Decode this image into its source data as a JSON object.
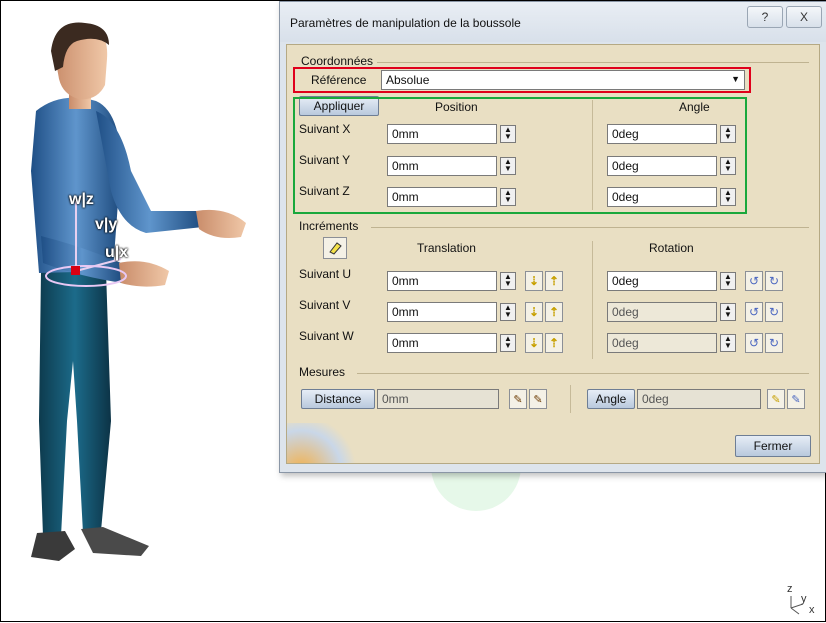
{
  "dialog": {
    "title": "Paramètres de manipulation de la boussole",
    "help_glyph": "?",
    "close_glyph": "X"
  },
  "coords": {
    "group_label": "Coordonnées",
    "reference_label": "Référence",
    "reference_value": "Absolue",
    "apply_label": "Appliquer",
    "position_header": "Position",
    "angle_header": "Angle",
    "rows": [
      {
        "label": "Suivant X",
        "position": "0mm",
        "angle": "0deg"
      },
      {
        "label": "Suivant Y",
        "position": "0mm",
        "angle": "0deg"
      },
      {
        "label": "Suivant Z",
        "position": "0mm",
        "angle": "0deg"
      }
    ]
  },
  "increments": {
    "group_label": "Incréments",
    "translation_header": "Translation",
    "rotation_header": "Rotation",
    "rows": [
      {
        "label": "Suivant U",
        "translation": "0mm",
        "rotation": "0deg"
      },
      {
        "label": "Suivant V",
        "translation": "0mm",
        "rotation": "0deg"
      },
      {
        "label": "Suivant W",
        "translation": "0mm",
        "rotation": "0deg"
      }
    ]
  },
  "measures": {
    "group_label": "Mesures",
    "distance_label": "Distance",
    "distance_value": "0mm",
    "angle_label": "Angle",
    "angle_value": "0deg"
  },
  "close_label": "Fermer",
  "compass_labels": {
    "w": "w|z",
    "v": "v|y",
    "u": "u|x"
  },
  "axis_labels": {
    "z": "z",
    "y": "y",
    "x": "x"
  },
  "colors": {
    "reference_highlight": "#e0001b",
    "coords_highlight": "#1aa83c",
    "watermark": "#33c44a",
    "dialog_body": "#e9dfc3",
    "button_blue": "#b9c9dd"
  }
}
